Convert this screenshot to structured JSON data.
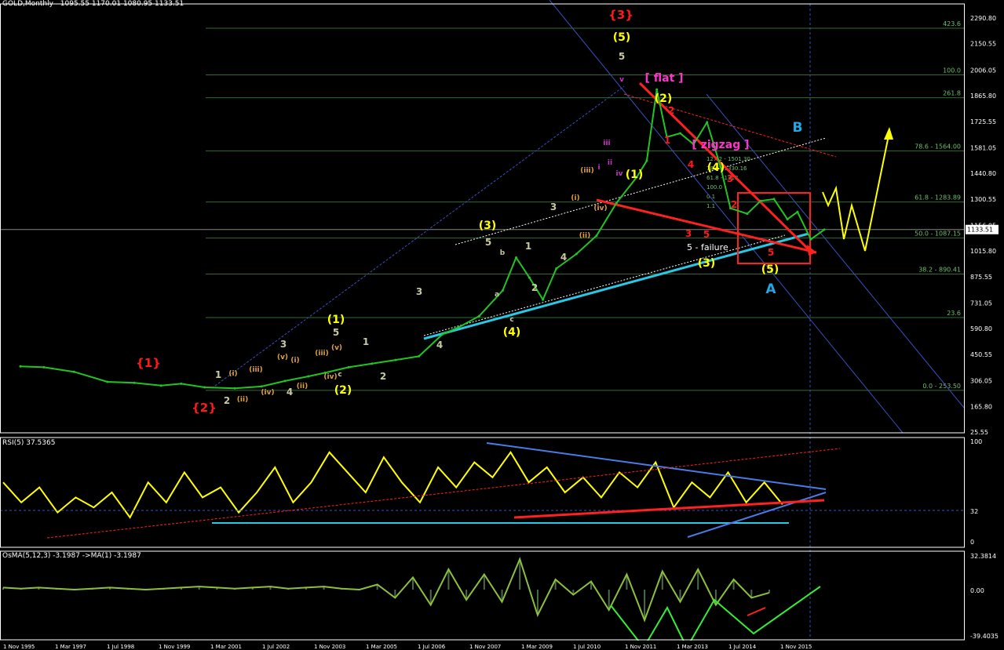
{
  "header": {
    "symbol": "GOLD,Monthly",
    "ohlc": "1095.55 1170.01 1080.95 1133.51"
  },
  "colors": {
    "background": "#000000",
    "price_line": "#22c422",
    "rsi_line": "#ffff00",
    "osma_line": "#8dc03c",
    "osma_hist": "#4b6b4b",
    "fib_line": "#2f6b2f",
    "fib_text": "#6fbf6f",
    "channel": "#3a4fbf",
    "trend_cyan": "#29c8e6",
    "trend_red": "#ff2020",
    "wave_yellow": "#ffff00",
    "wave_red": "#ff1a1a",
    "wave_magenta": "#ff33cc",
    "wave_blue": "#22a7e6",
    "wave_gray": "#c8c8a0",
    "wave_orange": "#e0a040",
    "wave_purple": "#cc33cc",
    "forecast_green": "#33ee33"
  },
  "chart_data": [
    {
      "type": "line",
      "panel": "price",
      "title": "GOLD,Monthly",
      "ohlc_last": {
        "open": 1095.55,
        "high": 1170.01,
        "low": 1080.95,
        "close": 1133.51
      },
      "y_ticks": [
        "2290.80",
        "2150.55",
        "2006.05",
        "1865.80",
        "1725.55",
        "1581.05",
        "1440.80",
        "1300.55",
        "1156.05",
        "1015.80",
        "875.55",
        "731.05",
        "590.80",
        "450.55",
        "306.05",
        "165.80",
        "25.55"
      ],
      "y_ticks_num": [
        2290.8,
        2150.55,
        2006.05,
        1865.8,
        1725.55,
        1581.05,
        1440.8,
        1300.55,
        1156.05,
        1015.8,
        875.55,
        731.05,
        590.8,
        450.55,
        306.05,
        165.8,
        25.55
      ],
      "current_price_label": "1133.51",
      "x_tick_labels": [
        "1 Nov 1995",
        "1 Mar 1997",
        "1 Jul 1998",
        "1 Nov 1999",
        "1 Mar 2001",
        "1 Jul 2002",
        "1 Nov 2003",
        "1 Mar 2005",
        "1 Jul 2006",
        "1 Nov 2007",
        "1 Mar 2009",
        "1 Jul 2010",
        "1 Nov 2011",
        "1 Mar 2013",
        "1 Jul 2014",
        "1 Nov 2015"
      ],
      "x": [
        "1995-11",
        "1996-06",
        "1997-03",
        "1998-01",
        "1998-09",
        "1999-05",
        "1999-11",
        "2000-06",
        "2001-03",
        "2001-11",
        "2002-06",
        "2003-01",
        "2003-06",
        "2004-01",
        "2004-08",
        "2005-03",
        "2005-10",
        "2006-05",
        "2006-10",
        "2007-04",
        "2007-11",
        "2008-03",
        "2008-07",
        "2008-11",
        "2009-03",
        "2009-09",
        "2010-03",
        "2010-09",
        "2011-03",
        "2011-06",
        "2011-09",
        "2011-12",
        "2012-04",
        "2012-08",
        "2012-12",
        "2013-04",
        "2013-07",
        "2013-12",
        "2014-04",
        "2014-08",
        "2014-12",
        "2015-03",
        "2015-07",
        "2015-11"
      ],
      "values": [
        385,
        380,
        355,
        300,
        295,
        280,
        290,
        270,
        265,
        275,
        305,
        330,
        350,
        380,
        400,
        420,
        440,
        560,
        600,
        660,
        800,
        980,
        870,
        750,
        920,
        1000,
        1100,
        1280,
        1420,
        1510,
        1900,
        1640,
        1660,
        1600,
        1720,
        1480,
        1250,
        1220,
        1290,
        1300,
        1190,
        1230,
        1080,
        1133
      ],
      "fib_levels": [
        {
          "label": "423.6",
          "value": 2235
        },
        {
          "label": "100.0",
          "value": 1980
        },
        {
          "label": "261.8",
          "value": 1855
        },
        {
          "label": "78.6 - 1564.00",
          "value": 1564
        },
        {
          "label": "61.8 - 1283.89",
          "value": 1284
        },
        {
          "label": "50.0 - 1087.15",
          "value": 1087
        },
        {
          "label": "38.2 - 890.41",
          "value": 890
        },
        {
          "label": "23.6",
          "value": 652
        },
        {
          "label": "0.0 - 253.50",
          "value": 253.5
        }
      ],
      "fib_cluster_labels": [
        "127.2 - 1501.30",
        "78.6 - 1330.16",
        "61.8 - 1318",
        "100.0",
        "0.1",
        "1.1"
      ],
      "annotations": {
        "red_main": [
          "{1}",
          "{2}",
          "{3}"
        ],
        "yellow_waves": [
          "(1)",
          "(2)",
          "(3)",
          "(4)",
          "(5)",
          "(1)",
          "(2)",
          "(4)",
          "(3)",
          "(5)"
        ],
        "gray_numbers": [
          "1",
          "2",
          "3",
          "4",
          "5",
          "1",
          "2",
          "3",
          "4",
          "5",
          "1",
          "2",
          "3",
          "4",
          "5"
        ],
        "roman_small": [
          "(i)",
          "(ii)",
          "(iii)",
          "(iv)",
          "(v)",
          "(i)",
          "(ii)",
          "(iii)",
          "(iv)",
          "(v)",
          "(i)",
          "(ii)",
          "(iii)",
          "(iv)"
        ],
        "magenta": [
          "[ flat ]",
          "[ zigzag ]"
        ],
        "blue_waves": [
          "A",
          "B"
        ],
        "misc_text": [
          "5 - failure",
          "a",
          "b",
          "c",
          "c",
          "iii",
          "ii",
          "i",
          "iv",
          "v"
        ],
        "red_small": [
          "1",
          "2",
          "3",
          "4",
          "5",
          "3",
          "5",
          "2"
        ]
      }
    },
    {
      "type": "line",
      "panel": "RSI",
      "title": "RSI(5) 37.5365",
      "y_ticks": [
        "100",
        "32",
        "0"
      ],
      "values": [
        60,
        40,
        55,
        30,
        45,
        35,
        50,
        25,
        60,
        40,
        70,
        45,
        55,
        30,
        50,
        75,
        40,
        60,
        90,
        70,
        50,
        85,
        60,
        40,
        75,
        55,
        80,
        65,
        90,
        60,
        75,
        50,
        65,
        45,
        70,
        55,
        80,
        35,
        60,
        45,
        70,
        40,
        60,
        38
      ]
    },
    {
      "type": "line",
      "panel": "OsMA",
      "title": "OsMA(5,12,3) -3.1987  ->MA(1) -3.1987",
      "y_ticks": [
        "32.3814",
        "0.00",
        "-39.4035"
      ],
      "values": [
        2,
        1,
        2,
        1,
        0,
        1,
        2,
        1,
        0,
        1,
        2,
        3,
        2,
        1,
        2,
        3,
        1,
        2,
        3,
        1,
        0,
        5,
        -8,
        12,
        -15,
        20,
        -10,
        15,
        -12,
        30,
        -25,
        10,
        -5,
        8,
        -20,
        15,
        -30,
        18,
        -12,
        20,
        -15,
        10,
        -8,
        -3
      ]
    }
  ]
}
